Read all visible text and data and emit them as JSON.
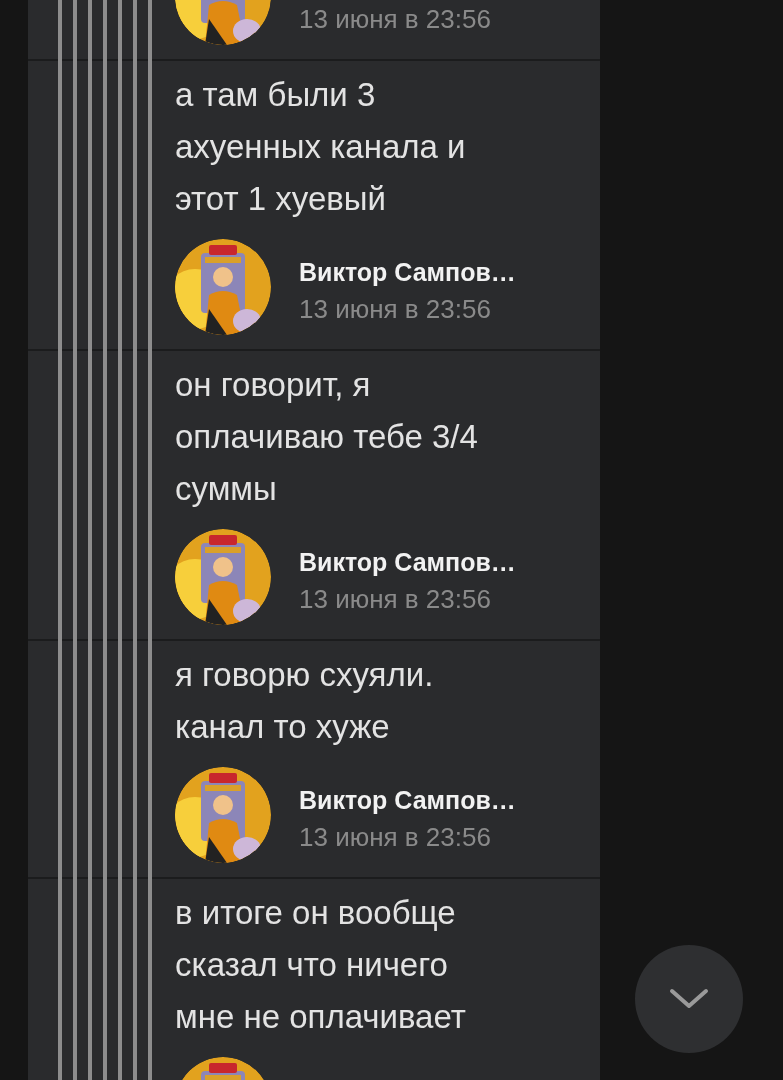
{
  "comments": [
    {
      "time": "13 июня в 23:56"
    },
    {
      "text": "а там были 3 ахуенных канала и этот 1 хуевый",
      "author": "Виктор Сампов…",
      "time": "13 июня в 23:56"
    },
    {
      "text": "он говорит, я оплачиваю тебе 3/4 суммы",
      "author": "Виктор Сампов…",
      "time": "13 июня в 23:56"
    },
    {
      "text": "я говорю схуяли. канал то хуже",
      "author": "Виктор Сампов…",
      "time": "13 июня в 23:56"
    },
    {
      "text": "в итоге он вообще сказал что ничего мне не оплачивает"
    }
  ],
  "scroll_down_button": {
    "kind": "chevron"
  }
}
